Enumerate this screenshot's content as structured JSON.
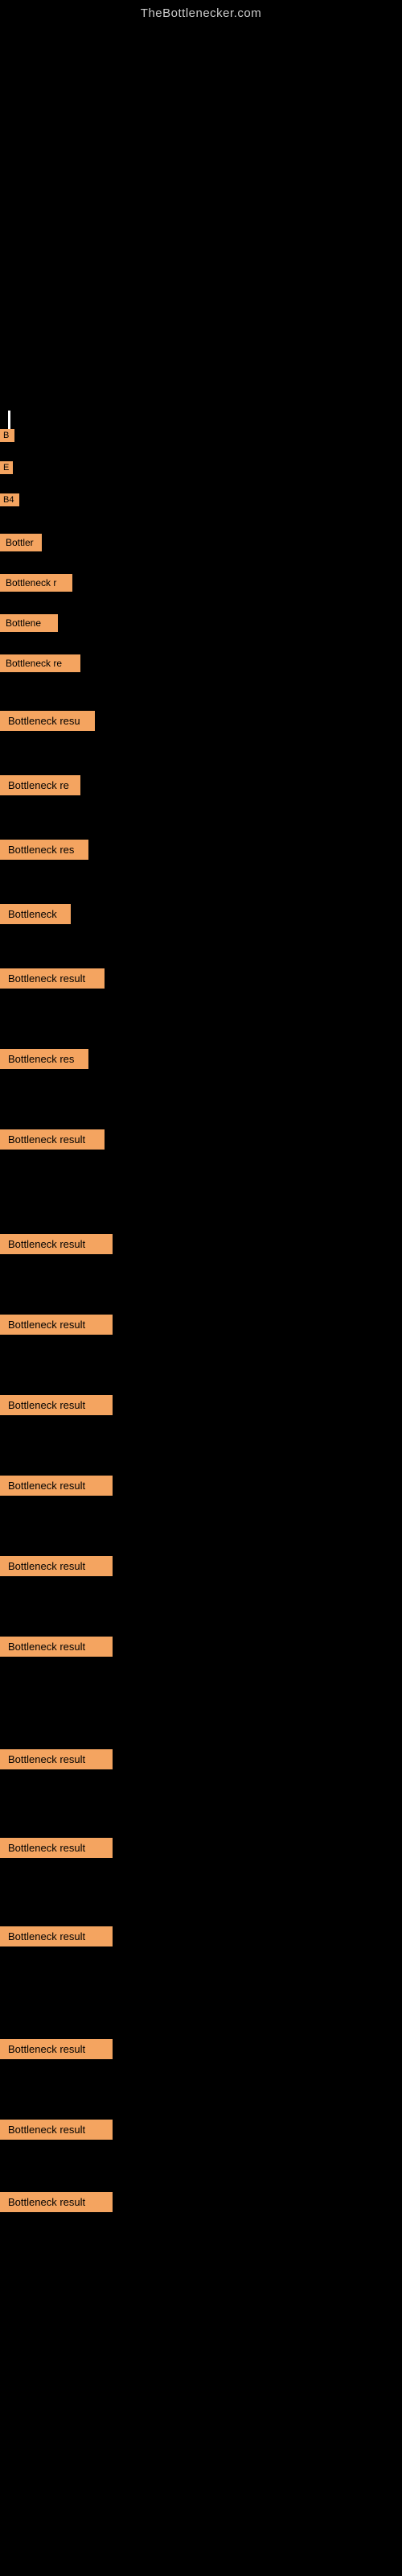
{
  "site": {
    "title": "TheBottlenecker.com"
  },
  "results": [
    {
      "id": 1,
      "label": "B",
      "size": "small"
    },
    {
      "id": 2,
      "label": "E",
      "size": "small"
    },
    {
      "id": 3,
      "label": "B4",
      "size": "small"
    },
    {
      "id": 4,
      "label": "Bottler",
      "size": "medium"
    },
    {
      "id": 5,
      "label": "Bottleneck r",
      "size": "medium"
    },
    {
      "id": 6,
      "label": "Bottlene",
      "size": "medium"
    },
    {
      "id": 7,
      "label": "Bottleneck re",
      "size": "medium"
    },
    {
      "id": 8,
      "label": "Bottleneck resu",
      "size": "large"
    },
    {
      "id": 9,
      "label": "Bottleneck re",
      "size": "large"
    },
    {
      "id": 10,
      "label": "Bottleneck res",
      "size": "large"
    },
    {
      "id": 11,
      "label": "Bottleneck",
      "size": "large"
    },
    {
      "id": 12,
      "label": "Bottleneck result",
      "size": "xl"
    },
    {
      "id": 13,
      "label": "Bottleneck res",
      "size": "xl"
    },
    {
      "id": 14,
      "label": "Bottleneck result",
      "size": "xl"
    },
    {
      "id": 15,
      "label": "Bottleneck result",
      "size": "xl"
    },
    {
      "id": 16,
      "label": "Bottleneck result",
      "size": "xl"
    },
    {
      "id": 17,
      "label": "Bottleneck result",
      "size": "xl"
    },
    {
      "id": 18,
      "label": "Bottleneck result",
      "size": "xl"
    },
    {
      "id": 19,
      "label": "Bottleneck result",
      "size": "xl"
    },
    {
      "id": 20,
      "label": "Bottleneck result",
      "size": "xl"
    },
    {
      "id": 21,
      "label": "Bottleneck result",
      "size": "xl"
    },
    {
      "id": 22,
      "label": "Bottleneck result",
      "size": "xl"
    },
    {
      "id": 23,
      "label": "Bottleneck result",
      "size": "xl"
    },
    {
      "id": 24,
      "label": "Bottleneck result",
      "size": "xl"
    },
    {
      "id": 25,
      "label": "Bottleneck result",
      "size": "xl"
    },
    {
      "id": 26,
      "label": "Bottleneck result",
      "size": "xl"
    }
  ]
}
